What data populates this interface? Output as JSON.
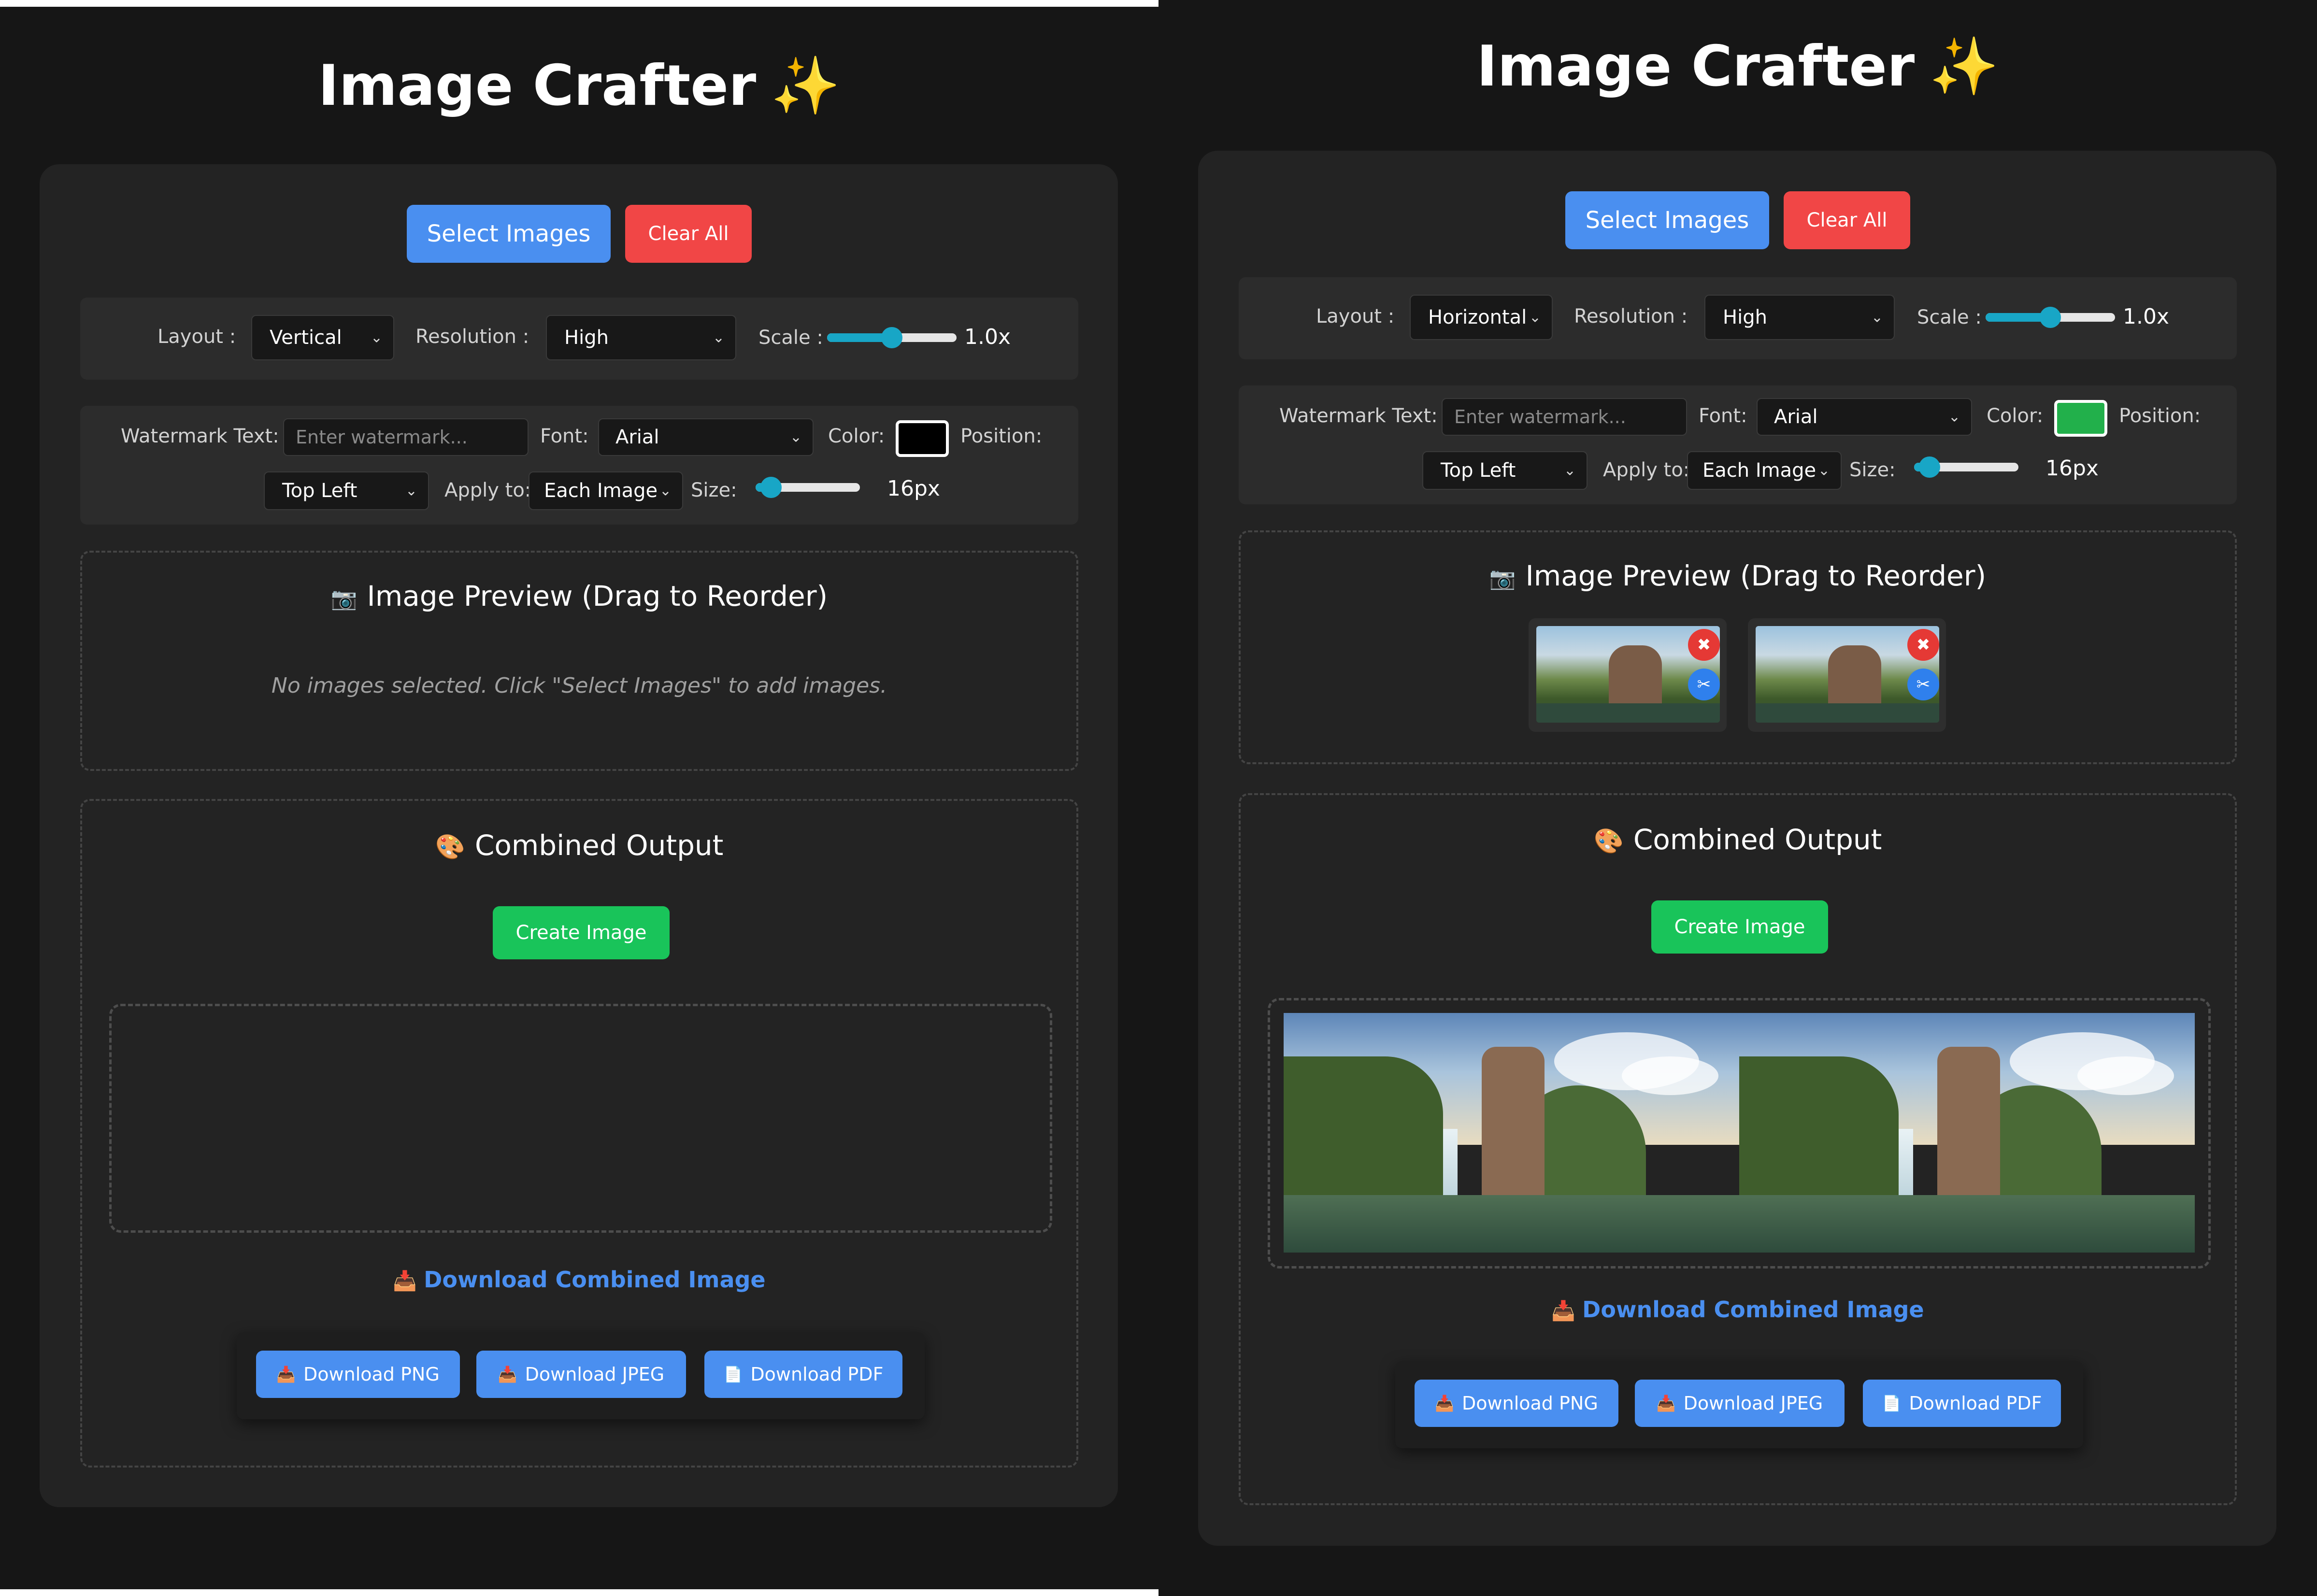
{
  "app": {
    "title": "Image Crafter",
    "sparkle_icon": "✨"
  },
  "colors": {
    "primary_blue": "#4a8ff0",
    "danger_red": "#f14646",
    "success_green": "#19c45a",
    "slider_teal": "#18a6c6",
    "background": "#161616",
    "card": "#232323"
  },
  "left": {
    "toolbar": {
      "select_images": "Select Images",
      "clear_all": "Clear All"
    },
    "settings": {
      "layout_label": "Layout :",
      "layout_value": "Vertical",
      "resolution_label": "Resolution :",
      "resolution_value": "High",
      "scale_label": "Scale :",
      "scale_value": "1.0x",
      "scale_level": 0.5
    },
    "watermark": {
      "text_label": "Watermark Text:",
      "text_placeholder": "Enter watermark...",
      "font_label": "Font:",
      "font_value": "Arial",
      "color_label": "Color:",
      "color_value": "#000000",
      "position_label": "Position:",
      "position_value": "Top Left",
      "apply_label": "Apply to:",
      "apply_value": "Each Image",
      "size_label": "Size:",
      "size_value": "16px",
      "size_level": 0.15
    },
    "preview": {
      "title": "Image Preview (Drag to Reorder)",
      "camera_icon": "📷",
      "empty_message": "No images selected. Click \"Select Images\" to add images."
    },
    "output": {
      "title": "Combined Output",
      "palette_icon": "🎨",
      "create_button": "Create Image",
      "download_heading": "Download Combined Image",
      "download_icon": "📥",
      "download_png": "Download PNG",
      "download_jpeg": "Download JPEG",
      "download_pdf": "Download PDF",
      "pdf_icon": "📄"
    }
  },
  "right": {
    "toolbar": {
      "select_images": "Select Images",
      "clear_all": "Clear All"
    },
    "settings": {
      "layout_label": "Layout :",
      "layout_value": "Horizontal",
      "resolution_label": "Resolution :",
      "resolution_value": "High",
      "scale_label": "Scale :",
      "scale_value": "1.0x",
      "scale_level": 0.5
    },
    "watermark": {
      "text_label": "Watermark Text:",
      "text_placeholder": "Enter watermark...",
      "font_label": "Font:",
      "font_value": "Arial",
      "color_label": "Color:",
      "color_value": "#22b04b",
      "position_label": "Position:",
      "position_value": "Top Left",
      "apply_label": "Apply to:",
      "apply_value": "Each Image",
      "size_label": "Size:",
      "size_value": "16px",
      "size_level": 0.15
    },
    "preview": {
      "title": "Image Preview (Drag to Reorder)",
      "camera_icon": "📷",
      "remove_icon": "✖",
      "crop_icon": "✂"
    },
    "output": {
      "title": "Combined Output",
      "palette_icon": "🎨",
      "create_button": "Create Image",
      "download_heading": "Download Combined Image",
      "download_icon": "📥",
      "download_png": "Download PNG",
      "download_jpeg": "Download JPEG",
      "download_pdf": "Download PDF",
      "pdf_icon": "📄"
    }
  }
}
